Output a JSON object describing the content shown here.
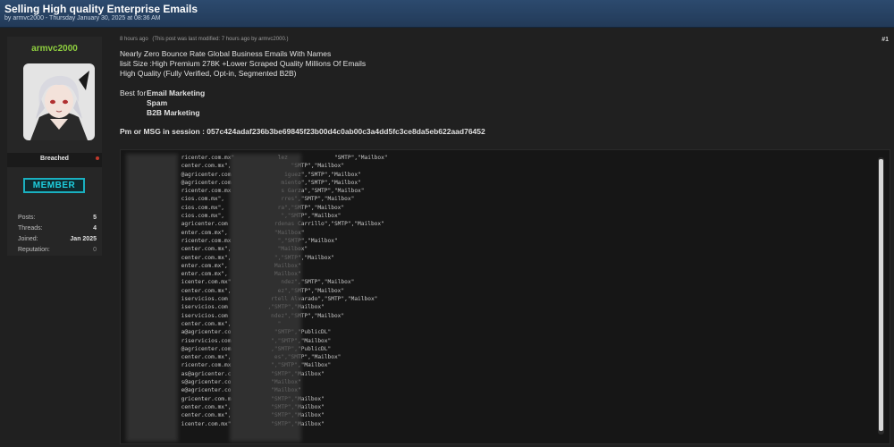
{
  "thread": {
    "title": "Selling High quality Enterprise Emails",
    "byline": "by armvc2000 - Thursday January 30, 2025 at 08:36 AM"
  },
  "author": {
    "username": "armvc2000",
    "rank": "Breached",
    "group": "MEMBER",
    "stats": [
      {
        "label": "Posts:",
        "value": "5"
      },
      {
        "label": "Threads:",
        "value": "4"
      },
      {
        "label": "Joined:",
        "value": "Jan 2025"
      },
      {
        "label": "Reputation:",
        "value": "0"
      }
    ]
  },
  "post": {
    "time": "8 hours ago",
    "modified": "(This post was last modified: 7 hours ago by armvc2000.)",
    "number": "#1",
    "lines": [
      "Nearly Zero Bounce Rate Global Business Emails With Names",
      "lisit Size :High Premium 278K +Lower Scraped  Quality Millions Of Emails",
      "High Quality (Fully Verified, Opt-in, Segmented B2B)"
    ],
    "best_for_label": "Best for",
    "best_for": [
      "Email Marketing",
      "Spam",
      "B2B Marketing"
    ],
    "contact": "Pm or MSG in session : 057c424adaf236b3be69845f23b00d4c0ab00c3a4dd5fc3ce8da5eb622aad76452"
  },
  "code_lines": [
    "                ricenter.com.mx\"             lez              \"SMTP\",\"Mailbox\"",
    "                center.com.mx\",                  \"SMTP\",\"Mailbox\"",
    "                @agricenter.com                iguez\",\"SMTP\",\"Mailbox\"",
    "                @agricenter.com               miento\",\"SMTP\",\"Mailbox\"",
    "                ricenter.com.mx               s Garza\",\"SMTP\",\"Mailbox\"",
    "                cios.com.mx\",                 rres\",\"SMTP\",\"Mailbox\"",
    "                cios.com.mx\",                ra\",\"SMTP\",\"Mailbox\"",
    "                cios.com.mx\",                 \",\"SMTP\",\"Mailbox\"",
    "                agricenter.com              rdenas Carrillo\",\"SMTP\",\"Mailbox\"",
    "                enter.com.mx\",              \"Mailbox\"",
    "                ricenter.com.mx              \",\"SMTP\",\"Mailbox\"",
    "                center.com.mx\",              \"Mailbox\"",
    "                center.com.mx\",             \",\"SMTP\",\"Mailbox\"",
    "                enter.com.mx\",              Mailbox\"",
    "                enter.com.mx\",              Mailbox\"",
    "                icenter.com.mx\"               ndez\",\"SMTP\",\"Mailbox\"",
    "                center.com.mx\",              ez\",\"SMTP\",\"Mailbox\"",
    "                iservicios.com             rtell Alvarado\",\"SMTP\",\"Mailbox\"",
    "                iservicios.com            ,\"SMTP\",\"Mailbox\"",
    "                iservicios.com             ndez\",\"SMTP\",\"Mailbox\"",
    "                center.com.mx\",              \"",
    "                a@agricenter.co             \"SMTP\",\"PublicDL\"",
    "                riservicios.com            \",\"SMTP\",\"Mailbox\"",
    "                @agricenter.com            ,\"SMTP\",\"PublicDL\"",
    "                center.com.mx\",             es\",\"SMTP\",\"Mailbox\"",
    "                ricenter.com.mx            \",\"SMTP\",\"Mailbox\"",
    "                as@agricenter.c            \"SMTP\",\"Mailbox\"",
    "                s@agricenter.co            \"Mailbox\"",
    "                e@agricenter.co            \"Mailbox\"",
    "                gricenter.com.m            \"SMTP\",\"Mailbox\"",
    "                center.com.mx\",            \"SMTP\",\"Mailbox\"",
    "                center.com.mx\",            \"SMTP\",\"Mailbox\"",
    "                icenter.com.mx\"            \"SMTP\",\"Mailbox\""
  ],
  "colors": {
    "header": "#2c4a6e",
    "username": "#8fcf3f",
    "member_badge": "#1ab0c0"
  }
}
